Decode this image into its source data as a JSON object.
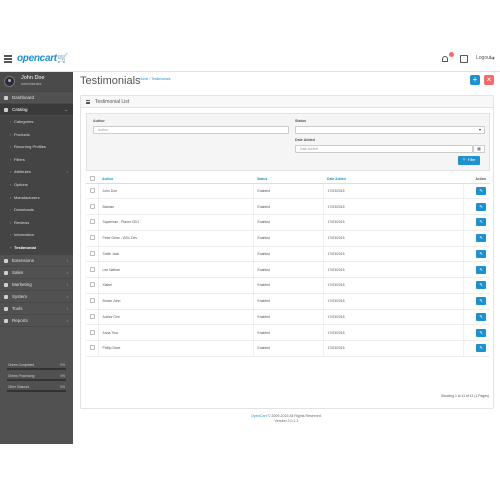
{
  "header": {
    "logo_text": "opencart",
    "logo_cart": "🛒",
    "logout_label": "Logout"
  },
  "sidebar": {
    "user_name": "John Doe",
    "user_role": "Administrator",
    "items": [
      {
        "label": "Dashboard",
        "icon": "dashboard-icon"
      },
      {
        "label": "Catalog",
        "icon": "tags-icon",
        "active": true
      }
    ],
    "catalog_children": [
      {
        "label": "Categories"
      },
      {
        "label": "Products"
      },
      {
        "label": "Recurring Profiles"
      },
      {
        "label": "Filters"
      },
      {
        "label": "Attributes",
        "has_children": true
      },
      {
        "label": "Options"
      },
      {
        "label": "Manufacturers"
      },
      {
        "label": "Downloads"
      },
      {
        "label": "Reviews"
      },
      {
        "label": "Information"
      },
      {
        "label": "Testimonial",
        "current": true
      }
    ],
    "more_items": [
      {
        "label": "Extensions",
        "icon": "puzzle-icon"
      },
      {
        "label": "Sales",
        "icon": "cart-icon"
      },
      {
        "label": "Marketing",
        "icon": "share-icon"
      },
      {
        "label": "System",
        "icon": "cog-icon"
      },
      {
        "label": "Tools",
        "icon": "wrench-icon"
      },
      {
        "label": "Reports",
        "icon": "chart-icon"
      }
    ],
    "stats": [
      {
        "label": "Orders Completed",
        "percent": "0%",
        "value": 0
      },
      {
        "label": "Orders Processing",
        "percent": "0%",
        "value": 0
      },
      {
        "label": "Other Statuses",
        "percent": "0%",
        "value": 0
      }
    ]
  },
  "page": {
    "title": "Testimonials",
    "breadcrumb_home": "Home",
    "breadcrumb_sep": "/",
    "breadcrumb_current": "Testimonials",
    "add_button": "+",
    "delete_button": "×",
    "panel_title": "Testimonial List"
  },
  "filter": {
    "author_label": "Author",
    "author_placeholder": "Author",
    "status_label": "Status",
    "status_value": "",
    "date_label": "Date Added",
    "date_placeholder": "Date Added",
    "button_label": "Filter"
  },
  "table": {
    "headers": {
      "author": "Author",
      "status": "Status",
      "date": "Date Added",
      "action": "Action"
    },
    "rows": [
      {
        "author": "John Doe",
        "status": "Enabled",
        "date": "17/03/2015"
      },
      {
        "author": "Batman",
        "status": "Enabled",
        "date": "17/03/2015"
      },
      {
        "author": "Superman - Planet CEO",
        "status": "Enabled",
        "date": "17/03/2015"
      },
      {
        "author": "Peter Dean - WGL Dev",
        "status": "Enabled",
        "date": "17/03/2015"
      },
      {
        "author": "Smith Jack",
        "status": "Enabled",
        "date": "17/03/2015"
      },
      {
        "author": "Lee Nathan",
        "status": "Enabled",
        "date": "17/03/2015"
      },
      {
        "author": "Xiabei",
        "status": "Enabled",
        "date": "17/03/2015"
      },
      {
        "author": "Brown John",
        "status": "Enabled",
        "date": "17/03/2015"
      },
      {
        "author": "Author One",
        "status": "Enabled",
        "date": "17/03/2015"
      },
      {
        "author": "Anna Tina",
        "status": "Enabled",
        "date": "17/03/2015"
      },
      {
        "author": "Phillip Dave",
        "status": "Enabled",
        "date": "17/03/2015"
      }
    ],
    "showing": "Showing 1 to 11 of 11 (1 Pages)"
  },
  "footer": {
    "line1_link": "OpenCart",
    "line1_rest": " © 2009-2015 All Rights Reserved.",
    "line2": "Version 2.0.1.1"
  }
}
